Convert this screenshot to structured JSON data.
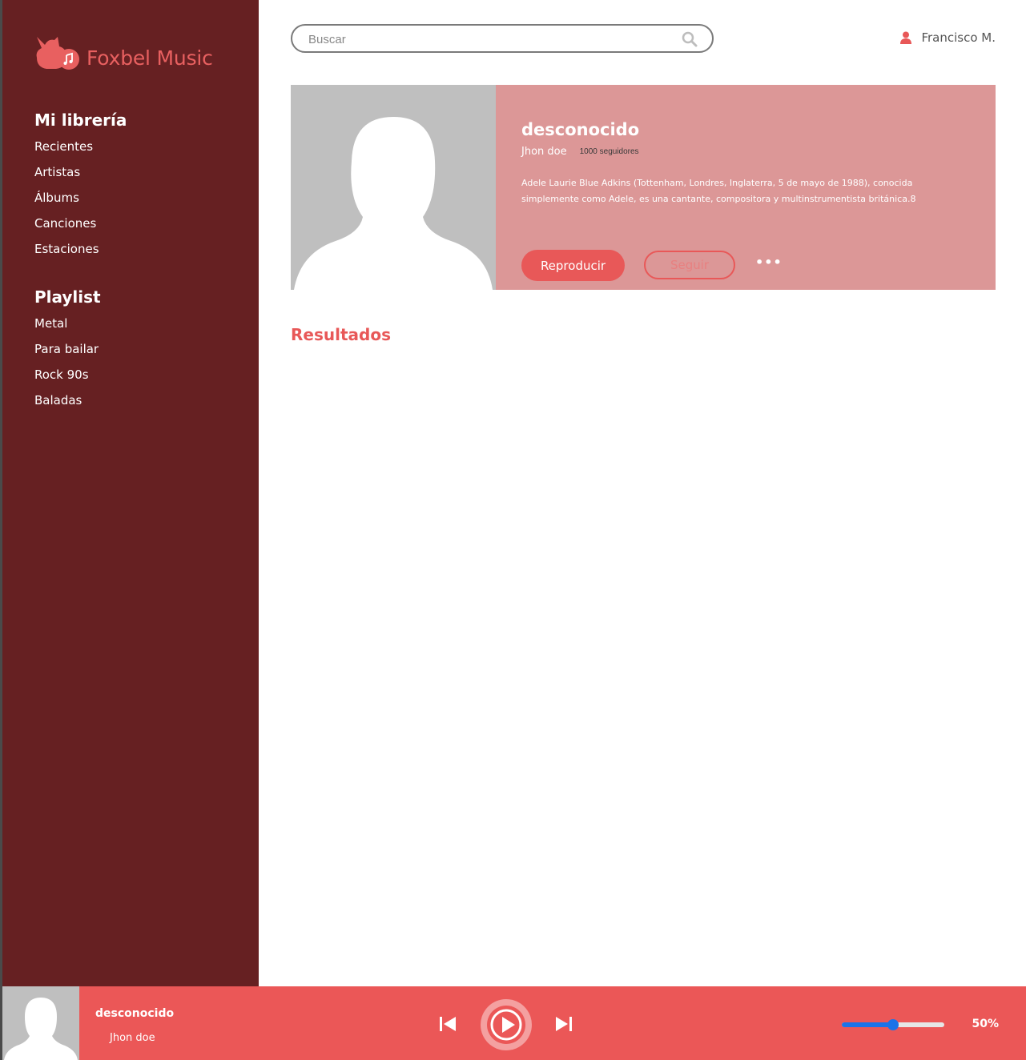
{
  "app": {
    "brand": "Foxbel Music",
    "logo_icon": "fox-music-logo-icon"
  },
  "sidebar": {
    "library": {
      "title": "Mi librería",
      "items": [
        {
          "label": "Recientes"
        },
        {
          "label": "Artistas"
        },
        {
          "label": "Álbums"
        },
        {
          "label": "Canciones"
        },
        {
          "label": "Estaciones"
        }
      ]
    },
    "playlist": {
      "title": "Playlist",
      "items": [
        {
          "label": "Metal"
        },
        {
          "label": "Para bailar"
        },
        {
          "label": "Rock 90s"
        },
        {
          "label": "Baladas"
        }
      ]
    }
  },
  "header": {
    "search": {
      "placeholder": "Buscar",
      "value": "",
      "icon": "search-icon"
    },
    "user": {
      "name": "Francisco M.",
      "icon": "user-icon"
    }
  },
  "artist": {
    "name": "desconocido",
    "author": "Jhon doe",
    "followers": "1000 seguidores",
    "bio": "Adele Laurie Blue Adkins (Tottenham, Londres, Inglaterra, 5 de mayo de 1988), conocida simplemente como Adele, es una cantante, compositora y multinstrumentista británica.8",
    "play_label": "Reproducir",
    "follow_label": "Seguir",
    "more_label": "•••"
  },
  "results": {
    "title": "Resultados"
  },
  "player": {
    "track": "desconocido",
    "artist": "Jhon doe",
    "volume_percent": 50,
    "volume_label": "50%"
  },
  "colors": {
    "sidebar_bg": "#662022",
    "accent": "#e85858",
    "card_bg": "#dc9797",
    "player_bg": "#eb5757",
    "volume": "#1a73e8"
  }
}
